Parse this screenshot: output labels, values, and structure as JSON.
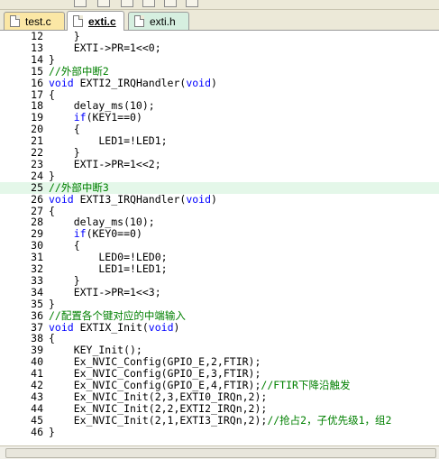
{
  "tabs": [
    {
      "label": "test.c",
      "active": false,
      "color": "#fbe7a5"
    },
    {
      "label": "exti.c",
      "active": true,
      "color": "#ffffff"
    },
    {
      "label": "exti.h",
      "active": false,
      "color": "#d6efe0"
    }
  ],
  "colors": {
    "keyword": "#0000ff",
    "comment": "#008000",
    "current_line": "#e4f7e9"
  },
  "lines": [
    {
      "num": "12",
      "segs": [
        {
          "t": "    }"
        }
      ]
    },
    {
      "num": "13",
      "segs": [
        {
          "t": "    EXTI->PR=1<<0;"
        }
      ]
    },
    {
      "num": "14",
      "segs": [
        {
          "t": "}"
        }
      ]
    },
    {
      "num": "15",
      "segs": [
        {
          "t": "//外部中断2",
          "c": "cm"
        }
      ]
    },
    {
      "num": "16",
      "segs": [
        {
          "t": "void",
          "c": "kw"
        },
        {
          "t": " EXTI2_IRQHandler("
        },
        {
          "t": "void",
          "c": "kw"
        },
        {
          "t": ")"
        }
      ]
    },
    {
      "num": "17",
      "segs": [
        {
          "t": "{"
        }
      ]
    },
    {
      "num": "18",
      "segs": [
        {
          "t": "    delay_ms(10);"
        }
      ]
    },
    {
      "num": "19",
      "segs": [
        {
          "t": "    "
        },
        {
          "t": "if",
          "c": "kw"
        },
        {
          "t": "(KEY1==0)"
        }
      ]
    },
    {
      "num": "20",
      "segs": [
        {
          "t": "    {"
        }
      ]
    },
    {
      "num": "21",
      "segs": [
        {
          "t": "        LED1=!LED1;"
        }
      ]
    },
    {
      "num": "22",
      "segs": [
        {
          "t": "    }"
        }
      ]
    },
    {
      "num": "23",
      "segs": [
        {
          "t": "    EXTI->PR=1<<2;"
        }
      ]
    },
    {
      "num": "24",
      "segs": [
        {
          "t": "}"
        }
      ]
    },
    {
      "num": "25",
      "hl": true,
      "segs": [
        {
          "t": "//外部中断3",
          "c": "cm"
        }
      ]
    },
    {
      "num": "26",
      "segs": [
        {
          "t": "void",
          "c": "kw"
        },
        {
          "t": " EXTI3_IRQHandler("
        },
        {
          "t": "void",
          "c": "kw"
        },
        {
          "t": ")"
        }
      ]
    },
    {
      "num": "27",
      "segs": [
        {
          "t": "{"
        }
      ]
    },
    {
      "num": "28",
      "segs": [
        {
          "t": "    delay_ms(10);"
        }
      ]
    },
    {
      "num": "29",
      "segs": [
        {
          "t": "    "
        },
        {
          "t": "if",
          "c": "kw"
        },
        {
          "t": "(KEY0==0)"
        }
      ]
    },
    {
      "num": "30",
      "segs": [
        {
          "t": "    {"
        }
      ]
    },
    {
      "num": "31",
      "segs": [
        {
          "t": "        LED0=!LED0;"
        }
      ]
    },
    {
      "num": "32",
      "segs": [
        {
          "t": "        LED1=!LED1;"
        }
      ]
    },
    {
      "num": "33",
      "segs": [
        {
          "t": "    }"
        }
      ]
    },
    {
      "num": "34",
      "segs": [
        {
          "t": "    EXTI->PR=1<<3;"
        }
      ]
    },
    {
      "num": "35",
      "segs": [
        {
          "t": "}"
        }
      ]
    },
    {
      "num": "36",
      "segs": [
        {
          "t": "//配置各个键对应的中端输入",
          "c": "cm"
        }
      ]
    },
    {
      "num": "37",
      "segs": [
        {
          "t": "void",
          "c": "kw"
        },
        {
          "t": " EXTIX_Init("
        },
        {
          "t": "void",
          "c": "kw"
        },
        {
          "t": ")"
        }
      ]
    },
    {
      "num": "38",
      "segs": [
        {
          "t": "{"
        }
      ]
    },
    {
      "num": "39",
      "segs": [
        {
          "t": "    KEY_Init();"
        }
      ]
    },
    {
      "num": "40",
      "segs": [
        {
          "t": "    Ex_NVIC_Config(GPIO_E,2,FTIR);"
        }
      ]
    },
    {
      "num": "41",
      "segs": [
        {
          "t": "    Ex_NVIC_Config(GPIO_E,3,FTIR);"
        }
      ]
    },
    {
      "num": "42",
      "segs": [
        {
          "t": "    Ex_NVIC_Config(GPIO_E,4,FTIR);"
        },
        {
          "t": "//FTIR下降沿触发",
          "c": "cm"
        }
      ]
    },
    {
      "num": "43",
      "segs": [
        {
          "t": "    Ex_NVIC_Init(2,3,EXTI0_IRQn,2);"
        }
      ]
    },
    {
      "num": "44",
      "segs": [
        {
          "t": "    Ex_NVIC_Init(2,2,EXTI2_IRQn,2);"
        }
      ]
    },
    {
      "num": "45",
      "segs": [
        {
          "t": "    Ex_NVIC_Init(2,1,EXTI3_IRQn,2);"
        },
        {
          "t": "//抢占2，子优先级1，组2",
          "c": "cm"
        }
      ]
    },
    {
      "num": "46",
      "segs": [
        {
          "t": "}"
        }
      ]
    }
  ]
}
